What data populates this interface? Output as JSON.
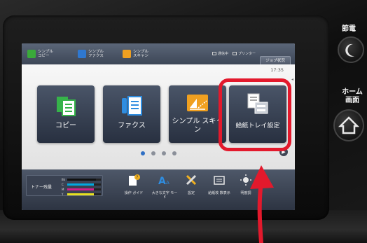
{
  "top_tabs": [
    {
      "label": "シンプル コピー",
      "color": "#3aaa3a"
    },
    {
      "label": "シンプル ファクス",
      "color": "#2f78d0"
    },
    {
      "label": "シンプル スキャン",
      "color": "#f0a020"
    }
  ],
  "status": {
    "processing": "通信中",
    "printer": "プリンター"
  },
  "job_status_button": "ジョブ状況",
  "clock": "17:35",
  "tiles": [
    {
      "label": "コピー",
      "icon": "copy-icon"
    },
    {
      "label": "ファクス",
      "icon": "fax-icon"
    },
    {
      "label": "シンプル スキャン",
      "icon": "simple-scan-icon"
    },
    {
      "label": "給紙トレイ設定",
      "icon": "paper-tray-icon"
    }
  ],
  "pager": {
    "pages": 4,
    "current": 1
  },
  "toner": {
    "label": "トナー残量",
    "rows": [
      {
        "name": "Bk",
        "color": "#111111",
        "level": 0.85
      },
      {
        "name": "C",
        "color": "#00a9e0",
        "level": 0.8
      },
      {
        "name": "M",
        "color": "#d0208a",
        "level": 0.8
      },
      {
        "name": "Y",
        "color": "#e8e020",
        "level": 0.8
      }
    ]
  },
  "shortcuts": [
    {
      "label": "操作 ガイド",
      "icon": "guide-icon"
    },
    {
      "label": "大きな文字 モード",
      "icon": "large-text-icon"
    },
    {
      "label": "設定",
      "icon": "settings-icon"
    },
    {
      "label": "給紙枚 数表示",
      "icon": "paper-count-icon"
    },
    {
      "label": "明度調",
      "icon": "brightness-icon"
    }
  ],
  "hardware": {
    "power_save": "節電",
    "home": "ホーム 画面"
  },
  "colors": {
    "highlight": "#e3192c",
    "arrow": "#e3192c"
  }
}
